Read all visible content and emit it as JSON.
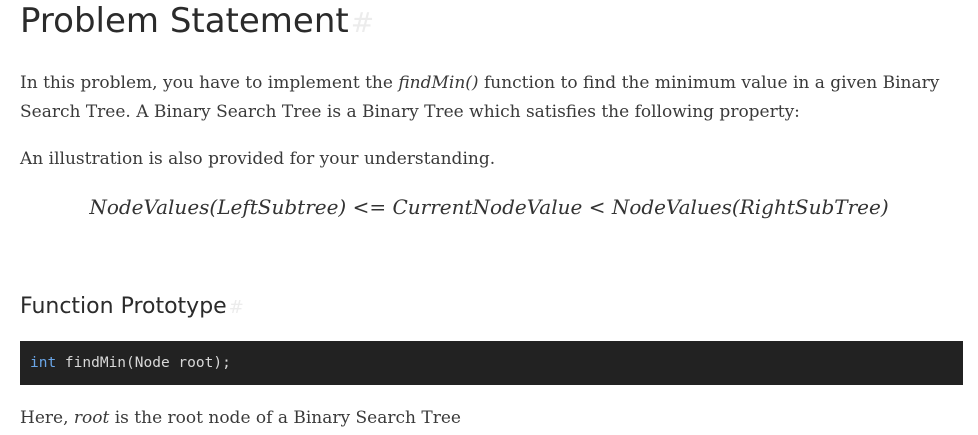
{
  "heading": {
    "title": "Problem Statement",
    "anchor": "#"
  },
  "intro": {
    "before": "In this problem, you have to implement the ",
    "function_name": "findMin()",
    "after": " function to find the minimum value in a given Binary Search Tree. A Binary Search Tree is a Binary Tree which satisfies the following property:"
  },
  "illustration_text": "An illustration is also provided for your understanding.",
  "formula": "NodeValues(LeftSubtree) <= CurrentNodeValue < NodeValues(RightSubTree)",
  "prototype_section": {
    "title": "Function Prototype",
    "anchor": "#"
  },
  "code": {
    "keyword": "int",
    "rest": " findMin(Node root);"
  },
  "note": {
    "before": "Here, ",
    "param": "root",
    "after": " is the root node of a Binary Search Tree"
  }
}
